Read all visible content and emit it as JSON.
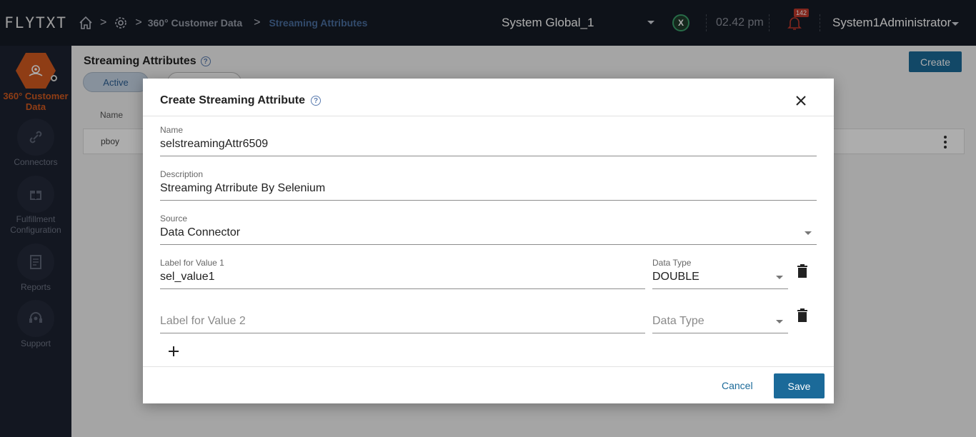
{
  "header": {
    "logo": "FLYTXT",
    "breadcrumb": [
      "360° Customer Data",
      "Streaming Attributes"
    ],
    "org_selector": "System Global_1",
    "x_badge": "X",
    "time": "02.42 pm",
    "notification_count": "142",
    "user": "System1Administrator"
  },
  "sidebar": {
    "items": [
      {
        "label": "360° Customer Data",
        "icon": "customer-data-icon",
        "active": true
      },
      {
        "label": "Connectors",
        "icon": "link-icon"
      },
      {
        "label": "Fulfillment Configuration",
        "icon": "gift-icon"
      },
      {
        "label": "Reports",
        "icon": "report-icon"
      },
      {
        "label": "Support",
        "icon": "headset-icon"
      }
    ]
  },
  "page": {
    "title": "Streaming Attributes",
    "create_label": "Create",
    "tabs": [
      "Active",
      ""
    ],
    "table": {
      "header": "Name",
      "rows": [
        {
          "name": "pboy"
        }
      ]
    }
  },
  "modal": {
    "title": "Create Streaming Attribute",
    "name": {
      "label": "Name",
      "value": "selstreamingAttr6509"
    },
    "description": {
      "label": "Description",
      "value": "Streaming Atrribute By Selenium"
    },
    "source": {
      "label": "Source",
      "value": "Data Connector"
    },
    "values": [
      {
        "label": "Label for Value 1",
        "value": "sel_value1",
        "type_label": "Data Type",
        "type_value": "DOUBLE"
      },
      {
        "label": "Label for Value 2",
        "value": "",
        "type_label": "Data Type",
        "type_value": ""
      }
    ],
    "cancel_label": "Cancel",
    "save_label": "Save"
  },
  "colors": {
    "accent": "#1b6a99",
    "brand": "#d35a1f",
    "topbar": "#161b26",
    "sidebar": "#1d2231"
  }
}
